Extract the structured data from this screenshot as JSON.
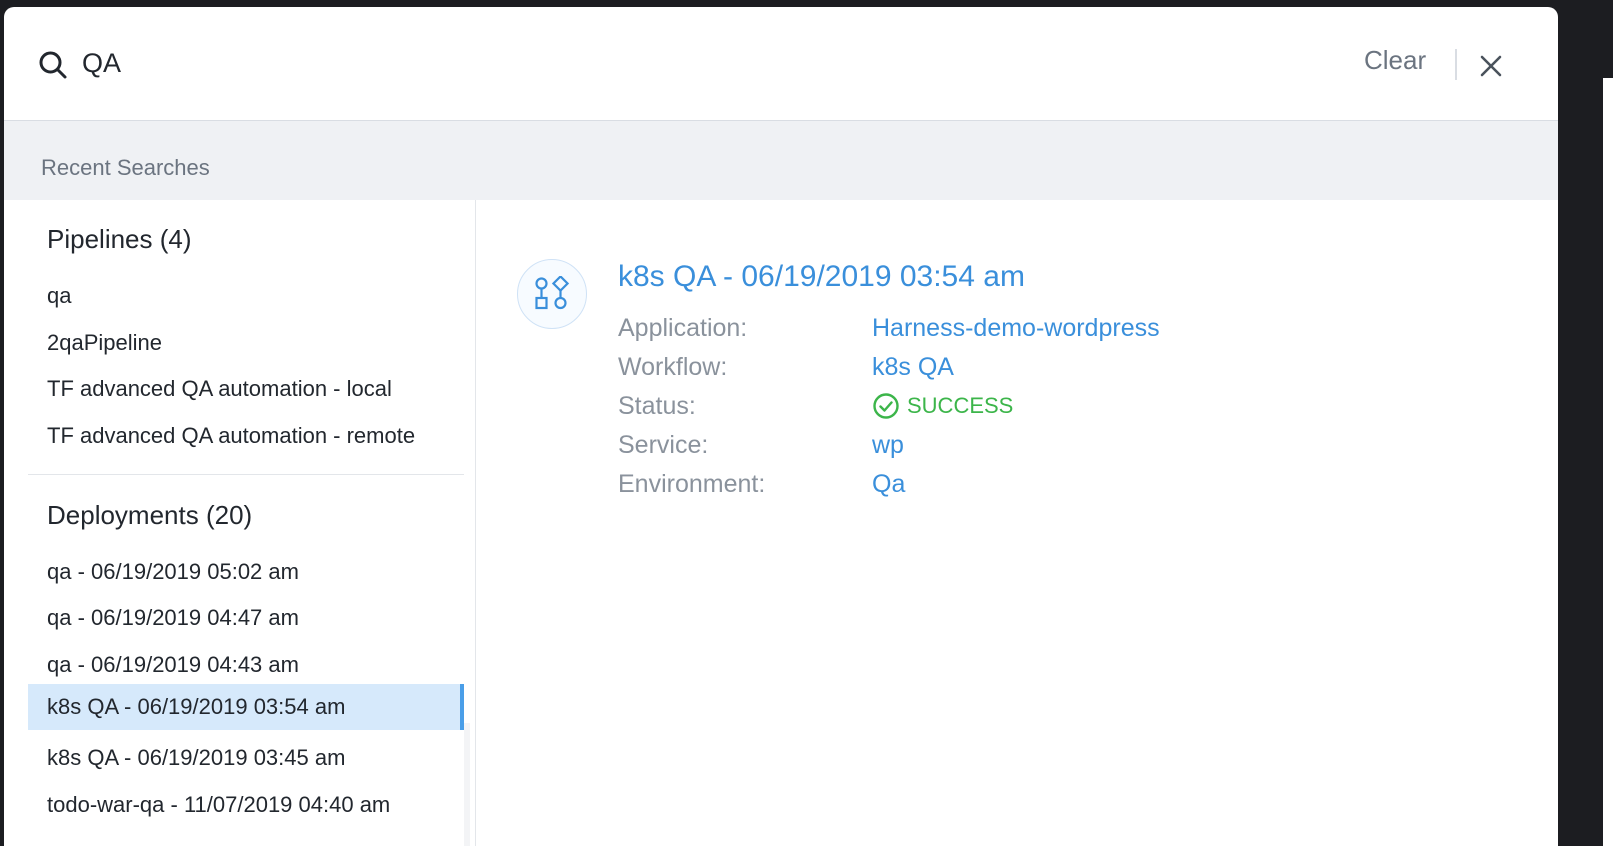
{
  "search": {
    "value": "QA",
    "clear_label": "Clear"
  },
  "recent": {
    "label": "Recent Searches"
  },
  "pipelines": {
    "title": "Pipelines (4)",
    "items": [
      "qa",
      "2qaPipeline",
      "TF advanced QA automation - local",
      "TF advanced QA automation - remote"
    ]
  },
  "deployments": {
    "title": "Deployments (20)",
    "items": [
      "qa - 06/19/2019 05:02 am",
      "qa - 06/19/2019 04:47 am",
      "qa - 06/19/2019 04:43 am",
      "k8s QA - 06/19/2019 03:54 am",
      "k8s QA - 06/19/2019 03:45 am",
      "todo-war-qa - 11/07/2019 04:40 am"
    ],
    "selected_index": 3
  },
  "detail": {
    "title": "k8s QA - 06/19/2019 03:54 am",
    "icon": "workflow-icon",
    "fields": [
      {
        "label": "Application:",
        "value": "Harness-demo-wordpress"
      },
      {
        "label": "Workflow:",
        "value": "k8s QA"
      },
      {
        "label": "Status:",
        "value": "SUCCESS"
      },
      {
        "label": "Service:",
        "value": "wp"
      },
      {
        "label": "Environment:",
        "value": "Qa"
      }
    ]
  },
  "colors": {
    "accent": "#3a8fdb",
    "selected_bg": "#d6e9fb",
    "success": "#3cb54a"
  }
}
